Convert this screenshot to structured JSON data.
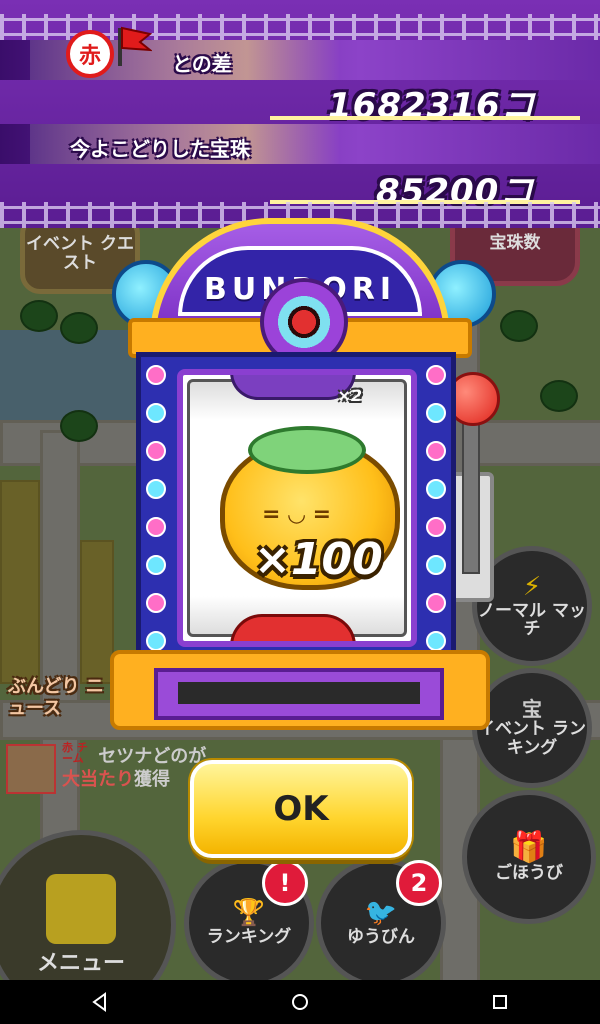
{
  "banner": {
    "aka_badge": "赤",
    "diff_label": "との差",
    "diff_value": "1682316コ",
    "taken_label": "今よこどりした宝珠",
    "taken_value": "85200コ"
  },
  "background": {
    "event_quest": "イベント クエスト",
    "houju_ranking": "宝珠数",
    "news_label": "ぶんどり ニュース",
    "news_line1": "セツナどのが",
    "news_line2_highlight": "大当たり",
    "news_line2_rest": "獲得",
    "news_badge": "赤 チーム"
  },
  "slot": {
    "title": "BUNDORI",
    "top_reel_multiplier": "×2",
    "center_multiplier": "×100"
  },
  "ok_button": "OK",
  "side_buttons": {
    "normal_match": "ノーマル マッチ",
    "event_ranking": "イベント ランキング",
    "event_ranking_icon": "宝",
    "reward": "ごほうび"
  },
  "bottom": {
    "menu": "メニュー",
    "ranking": "ランキング",
    "ranking_badge": "!",
    "mail": "ゆうびん",
    "mail_badge": "2"
  },
  "colors": {
    "banner_purple": "#6b2aa8",
    "accent_yellow": "#ffd52e",
    "team_red": "#e01b1b"
  }
}
